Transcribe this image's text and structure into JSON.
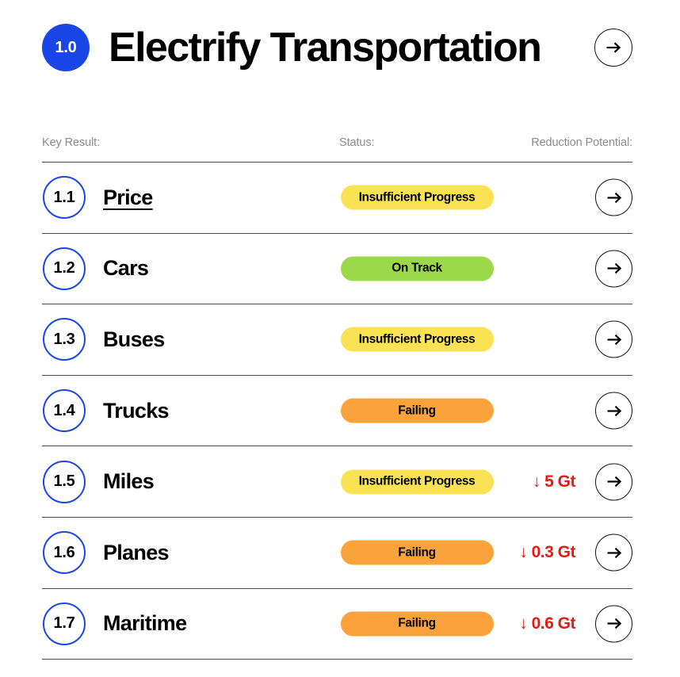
{
  "header": {
    "badge": "1.0",
    "title": "Electrify Transportation",
    "forward_icon": "arrow-right-icon"
  },
  "columns": {
    "key_result": "Key Result:",
    "status": "Status:",
    "reduction_potential": "Reduction Potential:"
  },
  "colors": {
    "brand_blue": "#1a46e8",
    "status_insufficient": "#fae255",
    "status_on_track": "#9bd94b",
    "status_failing": "#faa23c",
    "reduction_red": "#e31b14",
    "divider": "#4a4a4a",
    "column_header_text": "#8b8b90"
  },
  "rows": [
    {
      "number": "1.1",
      "label": "Price",
      "status": "Insufficient Progress",
      "status_kind": "insufficient",
      "reduction": "",
      "hovered": true
    },
    {
      "number": "1.2",
      "label": "Cars",
      "status": "On Track",
      "status_kind": "ontrack",
      "reduction": "",
      "hovered": false
    },
    {
      "number": "1.3",
      "label": "Buses",
      "status": "Insufficient Progress",
      "status_kind": "insufficient",
      "reduction": "",
      "hovered": false
    },
    {
      "number": "1.4",
      "label": "Trucks",
      "status": "Failing",
      "status_kind": "failing",
      "reduction": "",
      "hovered": false
    },
    {
      "number": "1.5",
      "label": "Miles",
      "status": "Insufficient Progress",
      "status_kind": "insufficient",
      "reduction": "↓ 5 Gt",
      "hovered": false
    },
    {
      "number": "1.6",
      "label": "Planes",
      "status": "Failing",
      "status_kind": "failing",
      "reduction": "↓ 0.3 Gt",
      "hovered": false
    },
    {
      "number": "1.7",
      "label": "Maritime",
      "status": "Failing",
      "status_kind": "failing",
      "reduction": "↓ 0.6 Gt",
      "hovered": false
    }
  ]
}
